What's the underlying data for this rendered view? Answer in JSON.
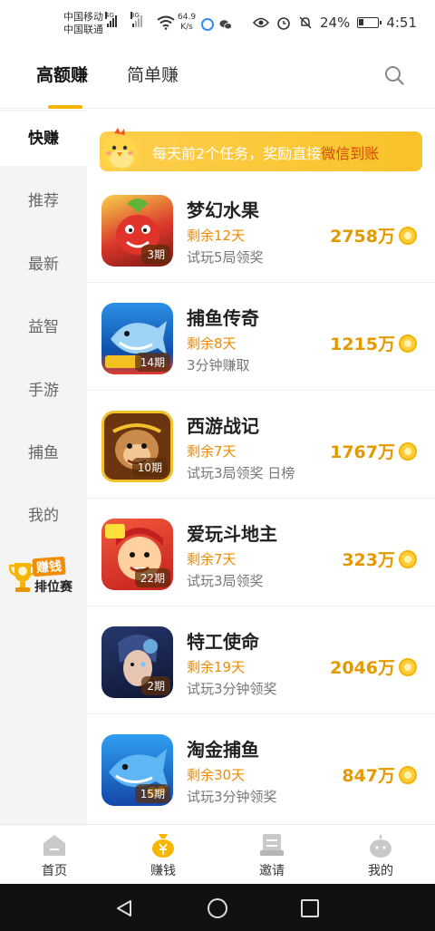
{
  "status_bar": {
    "carrier_1": "中国移动",
    "carrier_2": "中国联通",
    "net_1": "4G",
    "net_2": "3G",
    "speed_value": "64.9",
    "speed_unit": "K/s",
    "battery": "24%",
    "time": "4:51"
  },
  "top_tabs": [
    {
      "label": "高额赚",
      "active": true
    },
    {
      "label": "简单赚",
      "active": false
    }
  ],
  "sidebar": {
    "items": [
      {
        "label": "快赚",
        "active": true
      },
      {
        "label": "推荐"
      },
      {
        "label": "最新"
      },
      {
        "label": "益智"
      },
      {
        "label": "手游"
      },
      {
        "label": "捕鱼"
      },
      {
        "label": "我的"
      }
    ],
    "rank_badge": {
      "line1": "赚钱",
      "line2": "排位赛"
    }
  },
  "banner": {
    "text": "每天前2个任务，奖励直接",
    "highlight": "微信到账"
  },
  "games": [
    {
      "title": "梦幻水果",
      "days": "剩余12天",
      "desc": "试玩5局领奖",
      "reward": "2758万",
      "issue": "3期",
      "icon_colors": [
        "#d9362b",
        "#6bbf3a"
      ]
    },
    {
      "title": "捕鱼传奇",
      "days": "剩余8天",
      "desc": "3分钟赚取",
      "reward": "1215万",
      "issue": "14期",
      "icon_colors": [
        "#1e7ed6",
        "#f0c020"
      ]
    },
    {
      "title": "西游战记",
      "days": "剩余7天",
      "desc": "试玩3局领奖 日榜",
      "reward": "1767万",
      "issue": "10期",
      "icon_colors": [
        "#7a3b12",
        "#f2c230"
      ]
    },
    {
      "title": "爱玩斗地主",
      "days": "剩余7天",
      "desc": "试玩3局领奖",
      "reward": "323万",
      "issue": "22期",
      "icon_colors": [
        "#e0352a",
        "#ffb347"
      ]
    },
    {
      "title": "特工使命",
      "days": "剩余19天",
      "desc": "试玩3分钟领奖",
      "reward": "2046万",
      "issue": "2期",
      "icon_colors": [
        "#1a2a55",
        "#4fa3e0"
      ]
    },
    {
      "title": "淘金捕鱼",
      "days": "剩余30天",
      "desc": "试玩3分钟领奖",
      "reward": "847万",
      "issue": "15期",
      "icon_colors": [
        "#1446a8",
        "#37b0f0"
      ]
    }
  ],
  "bottom_nav": [
    {
      "label": "首页",
      "icon": "home-icon"
    },
    {
      "label": "赚钱",
      "icon": "money-bag-icon",
      "active": true
    },
    {
      "label": "邀请",
      "icon": "invite-icon"
    },
    {
      "label": "我的",
      "icon": "profile-icon"
    }
  ],
  "colors": {
    "accent": "#f5b400",
    "reward": "#e39a00",
    "days": "#f08a00"
  }
}
